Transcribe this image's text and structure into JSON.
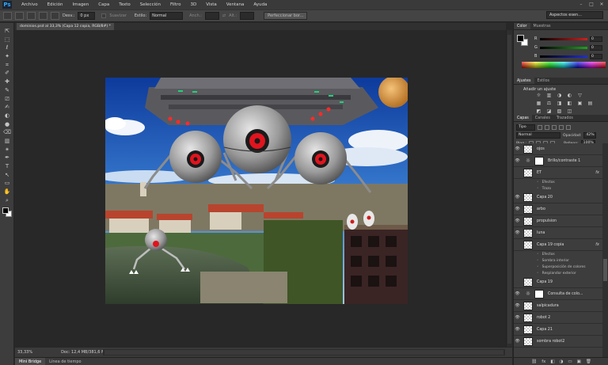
{
  "app": {
    "logo": "Ps"
  },
  "menu": [
    "Archivo",
    "Edición",
    "Imagen",
    "Capa",
    "Texto",
    "Selección",
    "Filtro",
    "3D",
    "Vista",
    "Ventana",
    "Ayuda"
  ],
  "window_buttons": [
    "–",
    "□",
    "✕"
  ],
  "options": {
    "desvan_label": "Desv.:",
    "desvan_value": "0 px",
    "suavizar_label": "Suavizar",
    "estilo_label": "Estilo:",
    "estilo_value": "Normal",
    "anch_label": "Anch.:",
    "alt_label": "Alt.:",
    "refine_button": "Perfeccionar bor...",
    "workspace": "Aspectos esen..."
  },
  "document": {
    "tab_title": "dominios.psd al 33,3% (Capa 12 copia, RGB/8#) *",
    "zoom": "33,33%",
    "doc_info": "Doc: 12,4 MB/381,6 MB"
  },
  "bottom_tabs": [
    "Mini Bridge",
    "Línea de tiempo"
  ],
  "color_panel": {
    "tabs": [
      "Color",
      "Muestras"
    ],
    "sliders": [
      {
        "letter": "R",
        "value": "0",
        "track_color": "#cc2020"
      },
      {
        "letter": "G",
        "value": "0",
        "track_color": "#1ea01e"
      },
      {
        "letter": "B",
        "value": "0",
        "track_color": "#2030cc"
      }
    ]
  },
  "adjust_panel": {
    "tabs": [
      "Ajustes",
      "Estilos"
    ],
    "title": "Añadir un ajuste",
    "row1": [
      "☼",
      "▥",
      "◑",
      "◐",
      "▽"
    ],
    "row2": [
      "▦",
      "⚖",
      "◨",
      "◧",
      "▣",
      "▤"
    ],
    "row3": [
      "◩",
      "◪",
      "▧",
      "◫"
    ]
  },
  "layers_panel": {
    "tabs": [
      "Capas",
      "Canales",
      "Trazados"
    ],
    "kind_filter": "Tipo",
    "blend_mode": "Normal",
    "opacity_label": "Opacidad:",
    "opacity_value": "42%",
    "lock_label": "Bloq.:",
    "fill_label": "Relleno:",
    "fill_value": "100%",
    "layers": [
      {
        "name": "ojos",
        "kind": "normal",
        "visible": true
      },
      {
        "name": "Brillo/contraste 1",
        "kind": "adjust",
        "visible": true
      },
      {
        "name": "ET",
        "kind": "normal",
        "visible": false,
        "fx": true
      },
      {
        "name": "Efectos",
        "kind": "sub"
      },
      {
        "name": "Trazo",
        "kind": "sub"
      },
      {
        "name": "Capa 20",
        "kind": "normal",
        "visible": true
      },
      {
        "name": "arbo",
        "kind": "normal",
        "visible": true
      },
      {
        "name": "propulsion",
        "kind": "normal",
        "visible": true
      },
      {
        "name": "luna",
        "kind": "normal",
        "visible": true
      },
      {
        "name": "Capa 19 copia",
        "kind": "normal",
        "visible": false,
        "fx": true
      },
      {
        "name": "Efectos",
        "kind": "sub"
      },
      {
        "name": "Sombra interior",
        "kind": "sub"
      },
      {
        "name": "Superposición de colores",
        "kind": "sub"
      },
      {
        "name": "Resplandor exterior",
        "kind": "sub"
      },
      {
        "name": "Capa 19",
        "kind": "normal",
        "visible": false
      },
      {
        "name": "Consulta de colo...",
        "kind": "adjust",
        "visible": true
      },
      {
        "name": "salpicadura",
        "kind": "normal",
        "visible": true
      },
      {
        "name": "robot 2",
        "kind": "normal",
        "visible": true
      },
      {
        "name": "Capa 21",
        "kind": "normal",
        "visible": true
      },
      {
        "name": "sombra robot2",
        "kind": "normal",
        "visible": true
      }
    ],
    "footer_icons": [
      "⛓",
      "fx",
      "◧",
      "◑",
      "▭",
      "▣",
      "🗑"
    ]
  },
  "tools": [
    "⇱",
    "⬚",
    "ℓ",
    "✦",
    "⌗",
    "✐",
    "✚",
    "✎",
    "⎚",
    "✍",
    "◐",
    "●",
    "⌫",
    "▥",
    "✴",
    "✒",
    "T",
    "↖",
    "▭",
    "✋",
    "⌕"
  ]
}
